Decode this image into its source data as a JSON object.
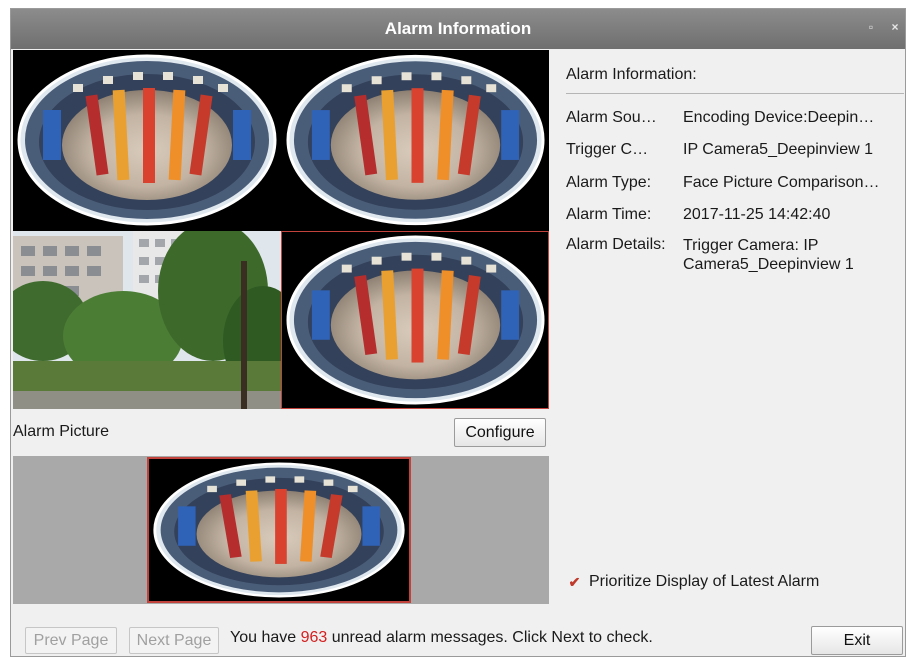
{
  "window": {
    "title": "Alarm Information"
  },
  "controls": {
    "restore_glyph": "▫",
    "close_glyph": "×"
  },
  "colors": {
    "accent_border": "#c2423c",
    "unread_count": "#d41f1f",
    "checkbox": "#c0392b"
  },
  "alarm_picture": {
    "label": "Alarm Picture",
    "configure_label": "Configure"
  },
  "info": {
    "heading": "Alarm Information:",
    "rows": [
      {
        "key": "Alarm Sou…",
        "value": "Encoding Device:Deepin…"
      },
      {
        "key": "Trigger C…",
        "value": "IP Camera5_Deepinview 1"
      },
      {
        "key": "Alarm Type:",
        "value": "Face Picture Comparison…"
      },
      {
        "key": "Alarm Time:",
        "value": "2017-11-25 14:42:40"
      },
      {
        "key": "Alarm Details:",
        "value": "Trigger Camera: IP Camera5_Deepinview 1"
      }
    ]
  },
  "prioritize": {
    "checked": true,
    "check_glyph": "✔",
    "label": "Prioritize Display of Latest Alarm"
  },
  "footer": {
    "prev_label": "Prev Page",
    "next_label": "Next Page",
    "msg_prefix": "You have ",
    "unread_count": "963",
    "msg_suffix": " unread alarm messages. Click Next to check.",
    "exit_label": "Exit"
  }
}
